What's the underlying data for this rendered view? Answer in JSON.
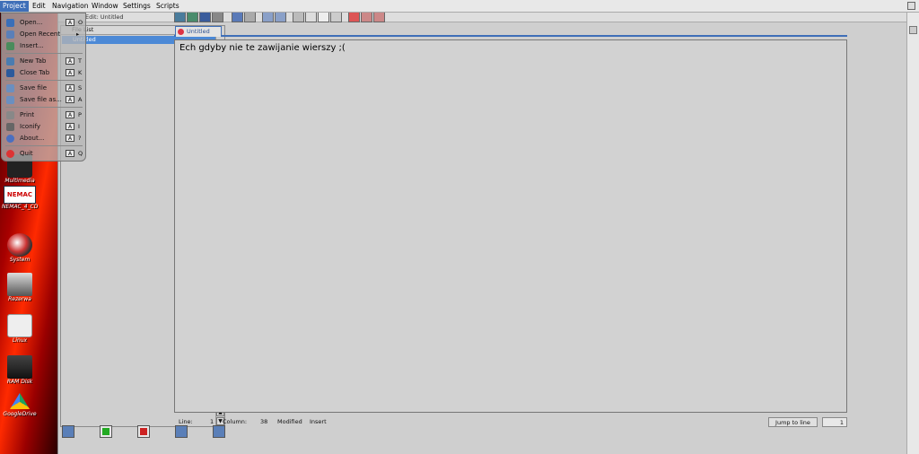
{
  "menubar": {
    "items": [
      "Project",
      "Edit",
      "Navigation",
      "Window",
      "Settings",
      "Scripts"
    ]
  },
  "window": {
    "title": "Edit: Untitled",
    "file_list_header": "File List",
    "file_list_item": "Untitled",
    "tab_label": "Untitled"
  },
  "editor": {
    "text": "Ech gdyby nie te zawijanie wierszy ;("
  },
  "status": {
    "line_label": "Line:",
    "line_value": "1",
    "column_label": "Column:",
    "column_value": "38",
    "modified": "Modified",
    "mode": "Insert",
    "jump_button": "Jump to line",
    "line_input": "1"
  },
  "dropdown": {
    "items": [
      {
        "label": "Open...",
        "key": "A",
        "shortcut": "O",
        "icon": "folder-icon"
      },
      {
        "label": "Open Recent",
        "key": "",
        "shortcut": "",
        "icon": "recent-icon"
      },
      {
        "label": "Insert...",
        "key": "",
        "shortcut": "",
        "icon": "insert-icon"
      },
      {
        "label": "New Tab",
        "key": "A",
        "shortcut": "T",
        "icon": "new-tab-icon"
      },
      {
        "label": "Close Tab",
        "key": "A",
        "shortcut": "K",
        "icon": "close-tab-icon"
      },
      {
        "label": "Save file",
        "key": "A",
        "shortcut": "S",
        "icon": "save-icon"
      },
      {
        "label": "Save file as...",
        "key": "A",
        "shortcut": "A",
        "icon": "save-as-icon"
      },
      {
        "label": "Print",
        "key": "A",
        "shortcut": "P",
        "icon": "print-icon"
      },
      {
        "label": "Iconify",
        "key": "A",
        "shortcut": "I",
        "icon": "iconify-icon"
      },
      {
        "label": "About...",
        "key": "A",
        "shortcut": "?",
        "icon": "about-icon"
      },
      {
        "label": "Quit",
        "key": "A",
        "shortcut": "Q",
        "icon": "quit-icon"
      }
    ]
  },
  "desktop": {
    "icons": [
      "Multimedia",
      "NEMAC_4_CD",
      "System",
      "Rezerwa",
      "Linux",
      "RAM Disk",
      "GoogleDrive"
    ],
    "nemac_logo": "NEMAC"
  },
  "colors": {
    "accent": "#3f6fb8",
    "selection": "#4c89d6",
    "wallpaper": "#c00000"
  }
}
